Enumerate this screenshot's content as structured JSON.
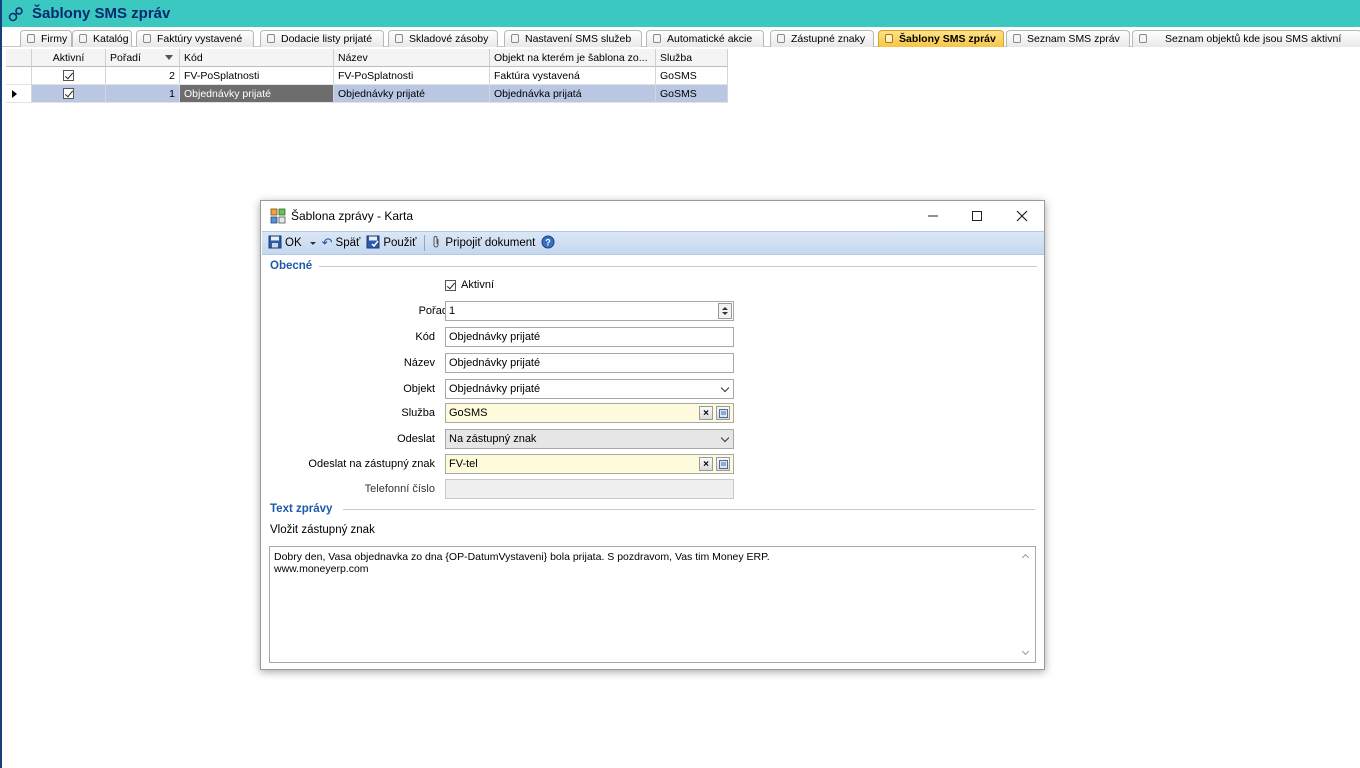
{
  "app": {
    "title": "Šablony SMS zpráv"
  },
  "tabs": [
    {
      "label": "Firmy",
      "active": false
    },
    {
      "label": "Katalóg",
      "active": false
    },
    {
      "label": "Faktúry vystavené",
      "active": false
    },
    {
      "label": "Dodacie listy prijaté",
      "active": false
    },
    {
      "label": "Skladové zásoby",
      "active": false
    },
    {
      "label": "Nastavení SMS služeb",
      "active": false
    },
    {
      "label": "Automatické akcie",
      "active": false
    },
    {
      "label": "Zástupné znaky",
      "active": false
    },
    {
      "label": "Šablony SMS zpráv",
      "active": true
    },
    {
      "label": "Seznam SMS zpráv",
      "active": false
    },
    {
      "label": "Seznam objektů kde jsou SMS aktivní",
      "active": false
    }
  ],
  "grid": {
    "columns": [
      "Aktivní",
      "Pořadí",
      "Kód",
      "Název",
      "Objekt na kterém je šablona zo...",
      "Služba"
    ],
    "rows": [
      {
        "aktivni": true,
        "poradi": "2",
        "kod": "FV-PoSplatnosti",
        "nazev": "FV-PoSplatnosti",
        "objekt": "Faktúra vystavená",
        "sluzba": "GoSMS",
        "selected": false
      },
      {
        "aktivni": true,
        "poradi": "1",
        "kod": "Objednávky prijaté",
        "nazev": "Objednávky prijaté",
        "objekt": "Objednávka prijatá",
        "sluzba": "GoSMS",
        "selected": true
      }
    ]
  },
  "dialog": {
    "title": "Šablona zprávy - Karta",
    "toolbar": {
      "ok": "OK",
      "back": "Späť",
      "apply": "Použiť",
      "attach": "Pripojiť dokument"
    },
    "section_general": "Obecné",
    "active_label": "Aktivní",
    "fields": {
      "poradi": {
        "label": "Pořadí",
        "value": "1"
      },
      "kod": {
        "label": "Kód",
        "value": "Objednávky prijaté"
      },
      "nazev": {
        "label": "Název",
        "value": "Objednávky prijaté"
      },
      "objekt": {
        "label": "Objekt",
        "value": "Objednávky prijaté"
      },
      "sluzba": {
        "label": "Služba",
        "value": "GoSMS"
      },
      "odeslat": {
        "label": "Odeslat",
        "value": "Na zástupný znak"
      },
      "odeslat_na": {
        "label": "Odeslat na zástupný znak",
        "value": "FV-tel"
      },
      "telefon": {
        "label": "Telefonní číslo",
        "value": ""
      }
    },
    "section_text": "Text zprávy",
    "insert_placeholder": "Vložit zástupný znak",
    "message_line1": "Dobry den, Vasa objednavka zo dna {OP-DatumVystaveni} bola prijata.  S pozdravom, Vas tim Money ERP.",
    "message_line2": "www.moneyerp.com"
  },
  "colors": {
    "titlebar": "#3ac8c0",
    "active_tab": "#f7c545",
    "selected_row": "#b9c7e3",
    "toolbar": "#c5d8ef",
    "section_title": "#1e5aa8",
    "lookup_field": "#fdfbdc"
  },
  "icons": [
    "app-icon",
    "tab-icon",
    "checkbox-checked-icon",
    "row-indicator-icon",
    "sort-desc-icon",
    "save-icon",
    "undo-icon",
    "apply-icon",
    "attach-icon",
    "help-icon",
    "minimize-icon",
    "maximize-icon",
    "close-icon",
    "chevron-down-icon",
    "clear-icon",
    "lookup-icon",
    "spin-icon"
  ]
}
